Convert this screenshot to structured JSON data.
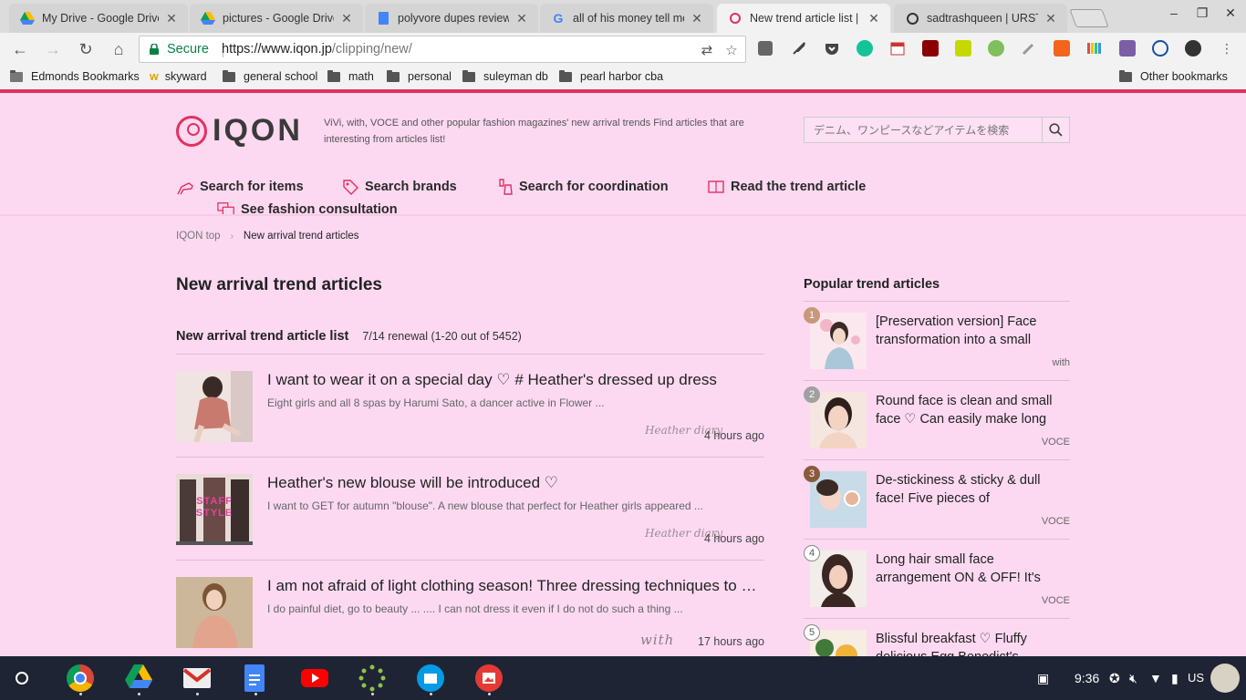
{
  "browser": {
    "tabs": [
      {
        "label": "My Drive - Google Drive",
        "icon": "google-drive-icon"
      },
      {
        "label": "pictures - Google Drive",
        "icon": "google-drive-icon"
      },
      {
        "label": "polyvore dupes review - G",
        "icon": "google-docs-icon"
      },
      {
        "label": "all of his money tell me t",
        "icon": "google-icon"
      },
      {
        "label": "New trend article list | IQ",
        "icon": "iqon-icon",
        "active": true
      },
      {
        "label": "sadtrashqueen | URSTYL",
        "icon": "urstyle-icon"
      }
    ],
    "omnibox": {
      "secure_label": "Secure",
      "url_main": "https://www.iqon.jp",
      "url_path": "/clipping/new/"
    },
    "bookmarks": [
      {
        "label": "Edmonds Bookmarks",
        "icon": "bookmarks-icon"
      },
      {
        "label": "skyward",
        "icon": "skyward-icon"
      },
      {
        "label": "general school",
        "icon": "folder-icon"
      },
      {
        "label": "math",
        "icon": "folder-icon"
      },
      {
        "label": "personal",
        "icon": "folder-icon"
      },
      {
        "label": "suleyman db",
        "icon": "folder-icon"
      },
      {
        "label": "pearl harbor cba",
        "icon": "folder-icon"
      }
    ],
    "other_bookmarks": "Other bookmarks"
  },
  "header": {
    "logo_text": "IQON",
    "tagline": "ViVi, with, VOCE and other popular fashion magazines' new arrival trends Find articles that are interesting from articles list!",
    "search_placeholder": "デニム、ワンピースなどアイテムを検索"
  },
  "nav": {
    "items": [
      {
        "label": "Search for items",
        "icon": "high-heel-icon"
      },
      {
        "label": "Search brands",
        "icon": "tag-icon"
      },
      {
        "label": "Search for coordination",
        "icon": "outfit-icon"
      },
      {
        "label": "Read the trend article",
        "icon": "magazine-icon"
      },
      {
        "label": "See fashion consultation",
        "icon": "chat-bubble-icon"
      }
    ]
  },
  "breadcrumb": {
    "home": "IQON top",
    "current": "New arrival trend articles"
  },
  "main": {
    "title": "New arrival trend articles",
    "list_title": "New arrival trend article list",
    "list_count": "7/14 renewal (1-20 out of 5452)",
    "articles": [
      {
        "title": "I want to wear it on a special day ♡ # Heather's dressed up dress",
        "desc": "Eight girls and all 8 spas by Harumi Sato, a dancer active in Flower ...",
        "source": "Heather diary",
        "time": "4 hours ago"
      },
      {
        "title": "Heather's new blouse will be introduced ♡",
        "desc": "I want to GET for autumn \"blouse\". A new blouse that perfect for Heather girls appeared ...",
        "source": "Heather diary",
        "time": "4 hours ago",
        "thumb_text": "STAFF STYLE"
      },
      {
        "title": "I am not afraid of light clothing season! Three dressing techniques to make a slim look",
        "desc": "I do painful diet, go to beauty ... .... I can not dress it even if I do not do such a thing ...",
        "source": "with",
        "time": "17 hours ago"
      }
    ]
  },
  "sidebar": {
    "title": "Popular trend articles",
    "items": [
      {
        "rank": "1",
        "title": "[Preservation version] Face transformation into a small",
        "source": "with",
        "rank_color": "#c9977a"
      },
      {
        "rank": "2",
        "title": "Round face is clean and small face ♡ Can easily make long",
        "source": "VOCE",
        "rank_color": "#a0a0a0"
      },
      {
        "rank": "3",
        "title": "De-stickiness & sticky & dull face! Five pieces of remodeling",
        "source": "VOCE",
        "rank_color": "#8a5a3c"
      },
      {
        "rank": "4",
        "title": "Long hair small face arrangement ON & OFF! It's",
        "source": "VOCE",
        "rank_color": "#ffffff"
      },
      {
        "rank": "5",
        "title": "Blissful breakfast ♡ Fluffy delicious Egg Benedict's",
        "source": "",
        "rank_color": "#ffffff"
      }
    ]
  },
  "taskbar": {
    "time": "9:36",
    "locale": "US",
    "apps": [
      "chrome-icon",
      "google-drive-icon",
      "gmail-icon",
      "google-docs-icon",
      "youtube-icon",
      "loading-icon",
      "files-icon",
      "photos-icon"
    ]
  },
  "colors": {
    "brand": "#e2305f",
    "page_bg": "#fcd9f1",
    "shelf": "#1e2433"
  }
}
